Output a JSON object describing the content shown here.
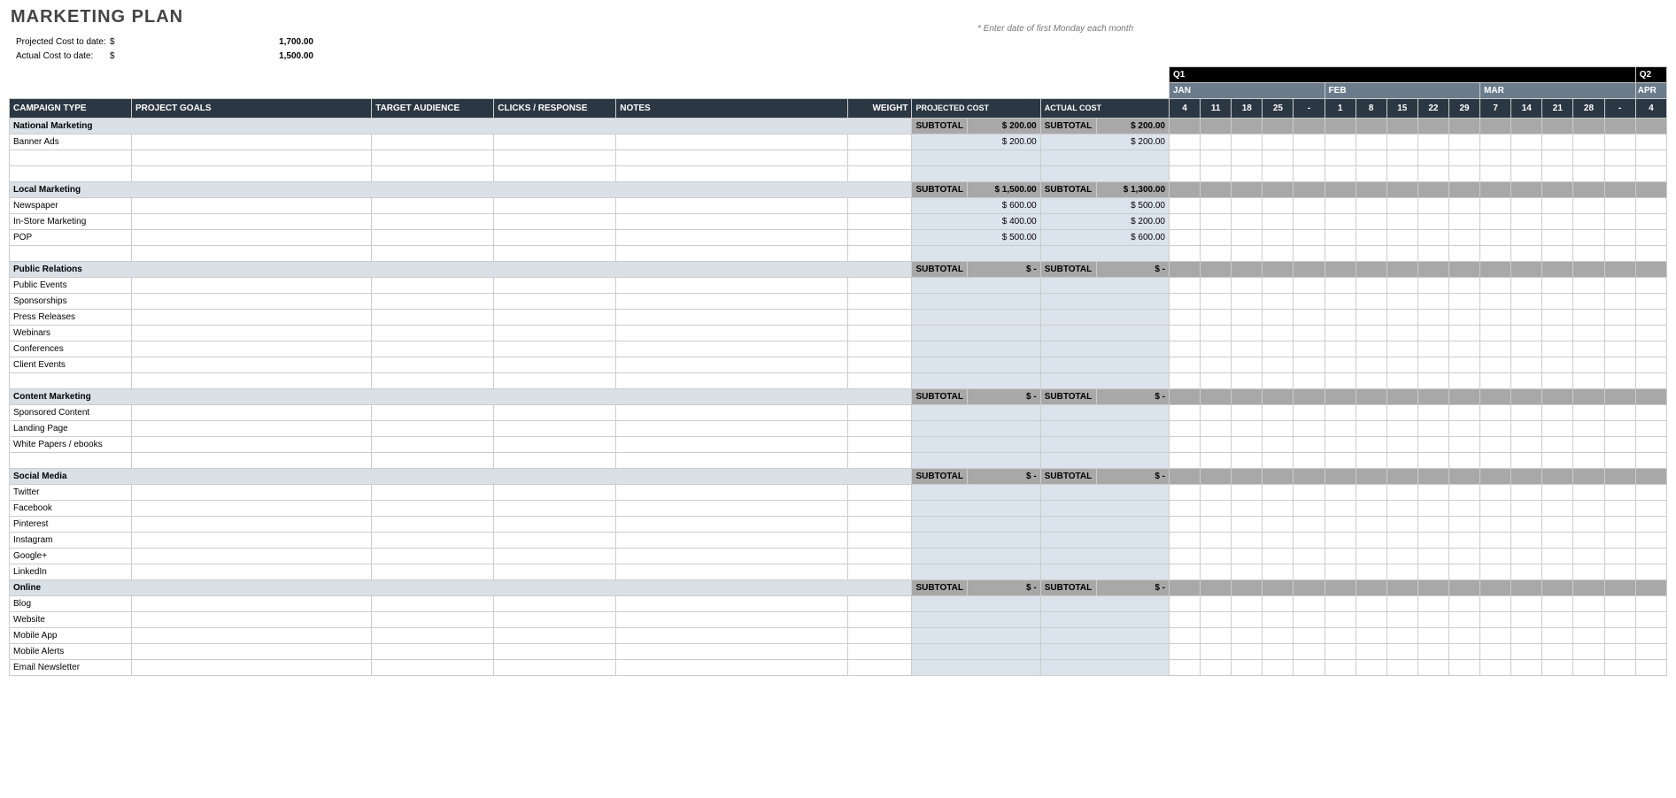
{
  "title": "MARKETING PLAN",
  "summary": {
    "projectedLabel": "Projected Cost to date:",
    "actualLabel": "Actual Cost to date:",
    "dollar": "$",
    "projected": "1,700.00",
    "actual": "1,500.00"
  },
  "dateNote": "* Enter date of first Monday each month",
  "headers": {
    "campaignType": "CAMPAIGN TYPE",
    "projectGoals": "PROJECT GOALS",
    "targetAudience": "TARGET AUDIENCE",
    "clicksResponse": "CLICKS / RESPONSE",
    "notes": "NOTES",
    "weight": "WEIGHT",
    "projectedCost": "PROJECTED COST",
    "actualCost": "ACTUAL COST",
    "subtotal": "SUBTOTAL",
    "q1": "Q1",
    "q2": "Q2"
  },
  "months": [
    {
      "name": "JAN",
      "days": [
        "4",
        "11",
        "18",
        "25",
        "-"
      ]
    },
    {
      "name": "FEB",
      "days": [
        "1",
        "8",
        "15",
        "22",
        "29"
      ]
    },
    {
      "name": "MAR",
      "days": [
        "7",
        "14",
        "21",
        "28",
        "-"
      ]
    },
    {
      "name": "APR",
      "days": [
        "4"
      ]
    }
  ],
  "dash": "-",
  "dollarDash": "$",
  "sections": [
    {
      "name": "National Marketing",
      "projSub": "$   200.00",
      "actSub": "$   200.00",
      "rows": [
        {
          "label": "Banner Ads",
          "proj": "$   200.00",
          "act": "$   200.00"
        },
        {
          "label": "",
          "proj": "",
          "act": ""
        },
        {
          "label": "",
          "proj": "",
          "act": ""
        }
      ]
    },
    {
      "name": "Local Marketing",
      "projSub": "$ 1,500.00",
      "actSub": "$ 1,300.00",
      "rows": [
        {
          "label": "Newspaper",
          "proj": "$   600.00",
          "act": "$   500.00"
        },
        {
          "label": "In-Store Marketing",
          "proj": "$   400.00",
          "act": "$   200.00"
        },
        {
          "label": "POP",
          "proj": "$   500.00",
          "act": "$   600.00"
        },
        {
          "label": "",
          "proj": "",
          "act": ""
        }
      ]
    },
    {
      "name": "Public Relations",
      "projSub": "$          -",
      "actSub": "$          -",
      "rows": [
        {
          "label": "Public Events",
          "proj": "",
          "act": ""
        },
        {
          "label": "Sponsorships",
          "proj": "",
          "act": ""
        },
        {
          "label": "Press Releases",
          "proj": "",
          "act": ""
        },
        {
          "label": "Webinars",
          "proj": "",
          "act": ""
        },
        {
          "label": "Conferences",
          "proj": "",
          "act": ""
        },
        {
          "label": "Client Events",
          "proj": "",
          "act": ""
        },
        {
          "label": "",
          "proj": "",
          "act": ""
        }
      ]
    },
    {
      "name": "Content Marketing",
      "projSub": "$          -",
      "actSub": "$          -",
      "rows": [
        {
          "label": "Sponsored Content",
          "proj": "",
          "act": ""
        },
        {
          "label": "Landing Page",
          "proj": "",
          "act": ""
        },
        {
          "label": "White Papers / ebooks",
          "proj": "",
          "act": ""
        },
        {
          "label": "",
          "proj": "",
          "act": ""
        }
      ]
    },
    {
      "name": "Social Media",
      "projSub": "$          -",
      "actSub": "$          -",
      "rows": [
        {
          "label": "Twitter",
          "proj": "",
          "act": ""
        },
        {
          "label": "Facebook",
          "proj": "",
          "act": ""
        },
        {
          "label": "Pinterest",
          "proj": "",
          "act": ""
        },
        {
          "label": "Instagram",
          "proj": "",
          "act": ""
        },
        {
          "label": "Google+",
          "proj": "",
          "act": ""
        },
        {
          "label": "LinkedIn",
          "proj": "",
          "act": ""
        }
      ]
    },
    {
      "name": "Online",
      "projSub": "$          -",
      "actSub": "$          -",
      "rows": [
        {
          "label": "Blog",
          "proj": "",
          "act": ""
        },
        {
          "label": "Website",
          "proj": "",
          "act": ""
        },
        {
          "label": "Mobile App",
          "proj": "",
          "act": ""
        },
        {
          "label": "Mobile Alerts",
          "proj": "",
          "act": ""
        },
        {
          "label": "Email Newsletter",
          "proj": "",
          "act": ""
        }
      ]
    }
  ]
}
